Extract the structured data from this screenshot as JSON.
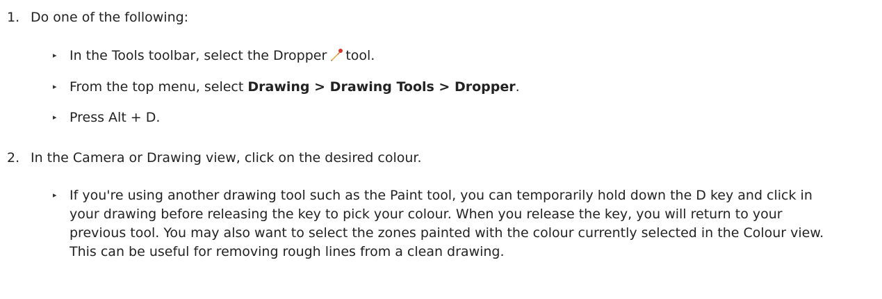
{
  "steps": [
    {
      "number": "1.",
      "text": "Do one of the following:",
      "bullets": [
        {
          "before": "In the Tools toolbar, select the Dropper",
          "icon": "dropper-icon",
          "after": "tool."
        },
        {
          "before": "From the top menu, select ",
          "bold": "Drawing > Drawing Tools > Dropper",
          "after": "."
        },
        {
          "text": "Press Alt + D."
        }
      ]
    },
    {
      "number": "2.",
      "text": "In the Camera or Drawing view, click on the desired colour.",
      "bullets": [
        {
          "text": "If you're using another drawing tool such as the Paint tool, you can temporarily hold down the D key and click in your drawing before releasing the key to pick your colour. When you release the key, you will return to your previous tool. You may also want to select the zones painted with the colour currently selected in the Colour view. This can be useful for removing rough lines from a clean drawing."
        }
      ]
    }
  ],
  "bullet_symbol": "▸",
  "colors": {
    "text": "#222222",
    "dropper_tip": "#d9342b",
    "dropper_body": "#f0a030"
  }
}
